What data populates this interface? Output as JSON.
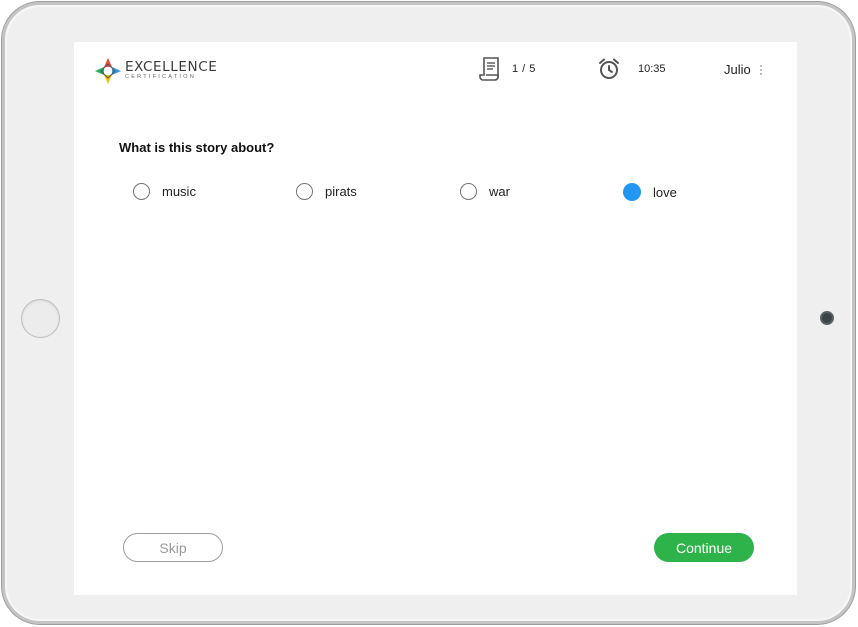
{
  "header": {
    "logo_title": "EXCELLENCE",
    "logo_subtitle": "CERTIFICATION",
    "progress": "1 / 5",
    "timer": "10:35",
    "user_name": "Julio"
  },
  "question": {
    "text": "What is this story about?",
    "options": [
      {
        "label": "music",
        "selected": false
      },
      {
        "label": "pirats",
        "selected": false
      },
      {
        "label": "war",
        "selected": false
      },
      {
        "label": "love",
        "selected": true
      }
    ]
  },
  "actions": {
    "skip_label": "Skip",
    "continue_label": "Continue"
  },
  "colors": {
    "accent_selected": "#2196f3",
    "continue_button": "#2eb34a",
    "device_frame": "#efefef"
  },
  "icons": {
    "progress": "scroll-document-icon",
    "timer": "alarm-clock-icon",
    "menu": "kebab-menu-icon"
  }
}
